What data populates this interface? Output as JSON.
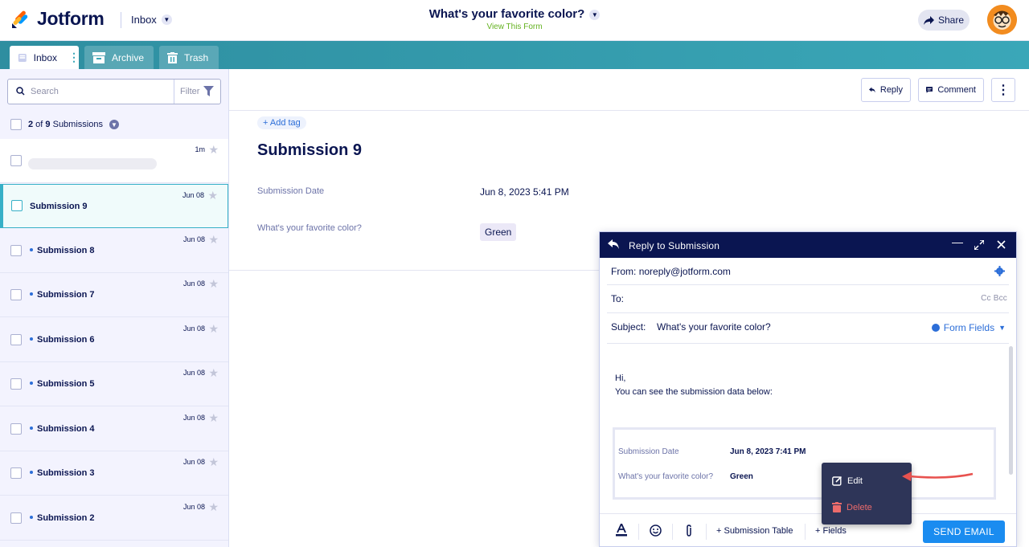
{
  "header": {
    "brand": "Jotform",
    "inbox_label": "Inbox",
    "form_title": "What's your favorite color?",
    "view_form": "View This Form",
    "share_label": "Share"
  },
  "tabs": [
    {
      "label": "Inbox",
      "active": true
    },
    {
      "label": "Archive",
      "active": false
    },
    {
      "label": "Trash",
      "active": false
    }
  ],
  "sidebar": {
    "search_placeholder": "Search",
    "filter_label": "Filter",
    "count_bold_a": "2",
    "count_mid": " of ",
    "count_bold_b": "9",
    "count_rest": " Submissions",
    "items": [
      {
        "name": "",
        "date": "1m",
        "unread": true,
        "selected": false
      },
      {
        "name": "Submission 9",
        "date": "Jun 08",
        "unread": false,
        "selected": true
      },
      {
        "name": "Submission 8",
        "date": "Jun 08",
        "unread": true,
        "selected": false
      },
      {
        "name": "Submission 7",
        "date": "Jun 08",
        "unread": true,
        "selected": false
      },
      {
        "name": "Submission 6",
        "date": "Jun 08",
        "unread": true,
        "selected": false
      },
      {
        "name": "Submission 5",
        "date": "Jun 08",
        "unread": true,
        "selected": false
      },
      {
        "name": "Submission 4",
        "date": "Jun 08",
        "unread": true,
        "selected": false
      },
      {
        "name": "Submission 3",
        "date": "Jun 08",
        "unread": true,
        "selected": false
      },
      {
        "name": "Submission 2",
        "date": "Jun 08",
        "unread": true,
        "selected": false
      }
    ]
  },
  "toolbar": {
    "reply_label": "Reply",
    "comment_label": "Comment"
  },
  "submission": {
    "add_tag": "+ Add tag",
    "title": "Submission 9",
    "date_label": "Submission Date",
    "date_value": "Jun 8, 2023 5:41 PM",
    "question_label": "What's your favorite color?",
    "answer": "Green"
  },
  "reply_modal": {
    "title": "Reply to Submission",
    "from_label": "From:",
    "from_value": "noreply@jotform.com",
    "to_label": "To:",
    "cc_bcc": "Cc  Bcc",
    "subject_label": "Subject:",
    "subject_value": "What's your favorite color?",
    "form_fields": "Form Fields",
    "greeting": "Hi,",
    "intro": "You can see the submission data below:",
    "table": [
      {
        "label": "Submission Date",
        "value": "Jun 8, 2023 7:41 PM"
      },
      {
        "label": "What's your favorite color?",
        "value": "Green"
      }
    ],
    "submission_table": "+ Submission Table",
    "fields": "+ Fields",
    "send_label": "SEND EMAIL"
  },
  "popover": {
    "edit_label": "Edit",
    "delete_label": "Delete"
  },
  "colors": {
    "navy": "#0a1551",
    "teal": "#37b0c7",
    "send_blue": "#1a8cf0",
    "delete_red": "#ec6b6b",
    "annotation_arrow": "#e8524f"
  }
}
